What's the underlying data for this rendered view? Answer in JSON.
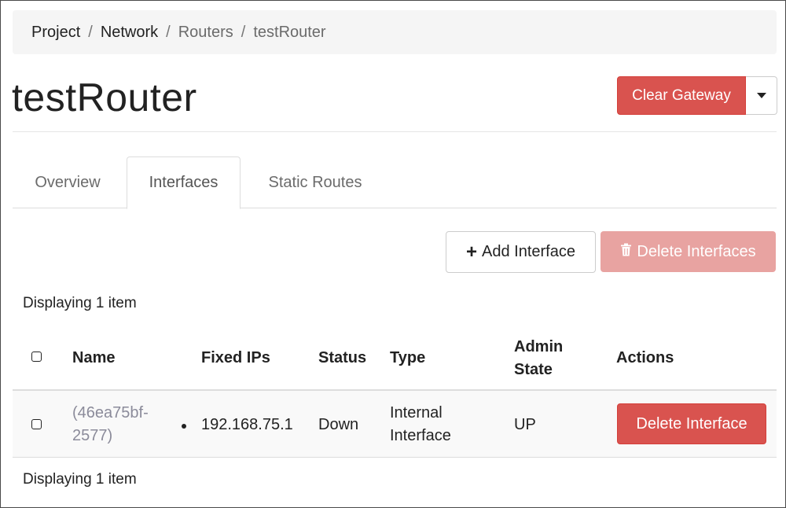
{
  "breadcrumb": {
    "items": [
      "Project",
      "Network",
      "Routers",
      "testRouter"
    ],
    "separator": "/"
  },
  "page_title": "testRouter",
  "header_actions": {
    "clear_gateway": "Clear Gateway",
    "more_icon": "chevron-down-icon"
  },
  "tabs": [
    {
      "label": "Overview",
      "active": false
    },
    {
      "label": "Interfaces",
      "active": true
    },
    {
      "label": "Static Routes",
      "active": false
    }
  ],
  "table_actions": {
    "add_interface": "Add Interface",
    "add_icon": "+",
    "delete_interfaces": "Delete Interfaces",
    "delete_icon": "trash-icon"
  },
  "count_top": "Displaying 1 item",
  "count_bottom": "Displaying 1 item",
  "table": {
    "headers": {
      "name": "Name",
      "fixed_ips": "Fixed IPs",
      "status": "Status",
      "type": "Type",
      "admin_state_line1": "Admin",
      "admin_state_line2": "State",
      "actions": "Actions"
    },
    "rows": [
      {
        "name_line1": "(46ea75bf-",
        "name_line2": "2577)",
        "fixed_ip": "192.168.75.1",
        "status": "Down",
        "type_line1": "Internal",
        "type_line2": "Interface",
        "admin_state": "UP",
        "action": "Delete Interface"
      }
    ]
  },
  "colors": {
    "danger": "#d9534f",
    "danger_disabled": "#e8a3a1",
    "link": "#8b8b9a"
  }
}
